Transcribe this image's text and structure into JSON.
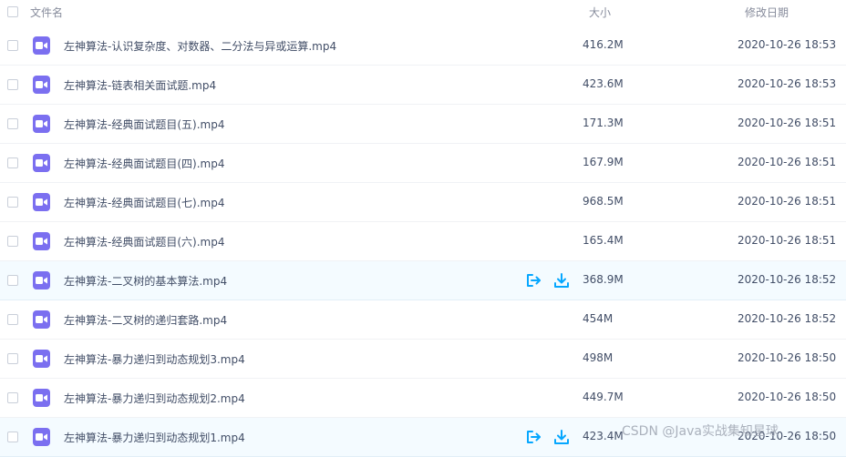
{
  "header": {
    "name_label": "文件名",
    "size_label": "大小",
    "date_label": "修改日期"
  },
  "files": [
    {
      "name": "左神算法-认识复杂度、对数器、二分法与异或运算.mp4",
      "size": "416.2M",
      "date": "2020-10-26 18:53",
      "highlighted": false
    },
    {
      "name": "左神算法-链表相关面试题.mp4",
      "size": "423.6M",
      "date": "2020-10-26 18:53",
      "highlighted": false
    },
    {
      "name": "左神算法-经典面试题目(五).mp4",
      "size": "171.3M",
      "date": "2020-10-26 18:51",
      "highlighted": false
    },
    {
      "name": "左神算法-经典面试题目(四).mp4",
      "size": "167.9M",
      "date": "2020-10-26 18:51",
      "highlighted": false
    },
    {
      "name": "左神算法-经典面试题目(七).mp4",
      "size": "968.5M",
      "date": "2020-10-26 18:51",
      "highlighted": false
    },
    {
      "name": "左神算法-经典面试题目(六).mp4",
      "size": "165.4M",
      "date": "2020-10-26 18:51",
      "highlighted": false
    },
    {
      "name": "左神算法-二叉树的基本算法.mp4",
      "size": "368.9M",
      "date": "2020-10-26 18:52",
      "highlighted": true
    },
    {
      "name": "左神算法-二叉树的递归套路.mp4",
      "size": "454M",
      "date": "2020-10-26 18:52",
      "highlighted": false
    },
    {
      "name": "左神算法-暴力递归到动态规划3.mp4",
      "size": "498M",
      "date": "2020-10-26 18:50",
      "highlighted": false
    },
    {
      "name": "左神算法-暴力递归到动态规划2.mp4",
      "size": "449.7M",
      "date": "2020-10-26 18:50",
      "highlighted": false
    },
    {
      "name": "左神算法-暴力递归到动态规划1.mp4",
      "size": "423.4M",
      "date": "2020-10-26 18:50",
      "highlighted": true
    }
  ],
  "icons": {
    "file": "video-file-icon",
    "share": "share-icon",
    "download": "download-icon"
  },
  "colors": {
    "file_icon": "#7b6ff0",
    "action_icon": "#06a7ff",
    "row_highlight": "#f4fbff"
  },
  "watermark": "CSDN @Java实战集知星球"
}
